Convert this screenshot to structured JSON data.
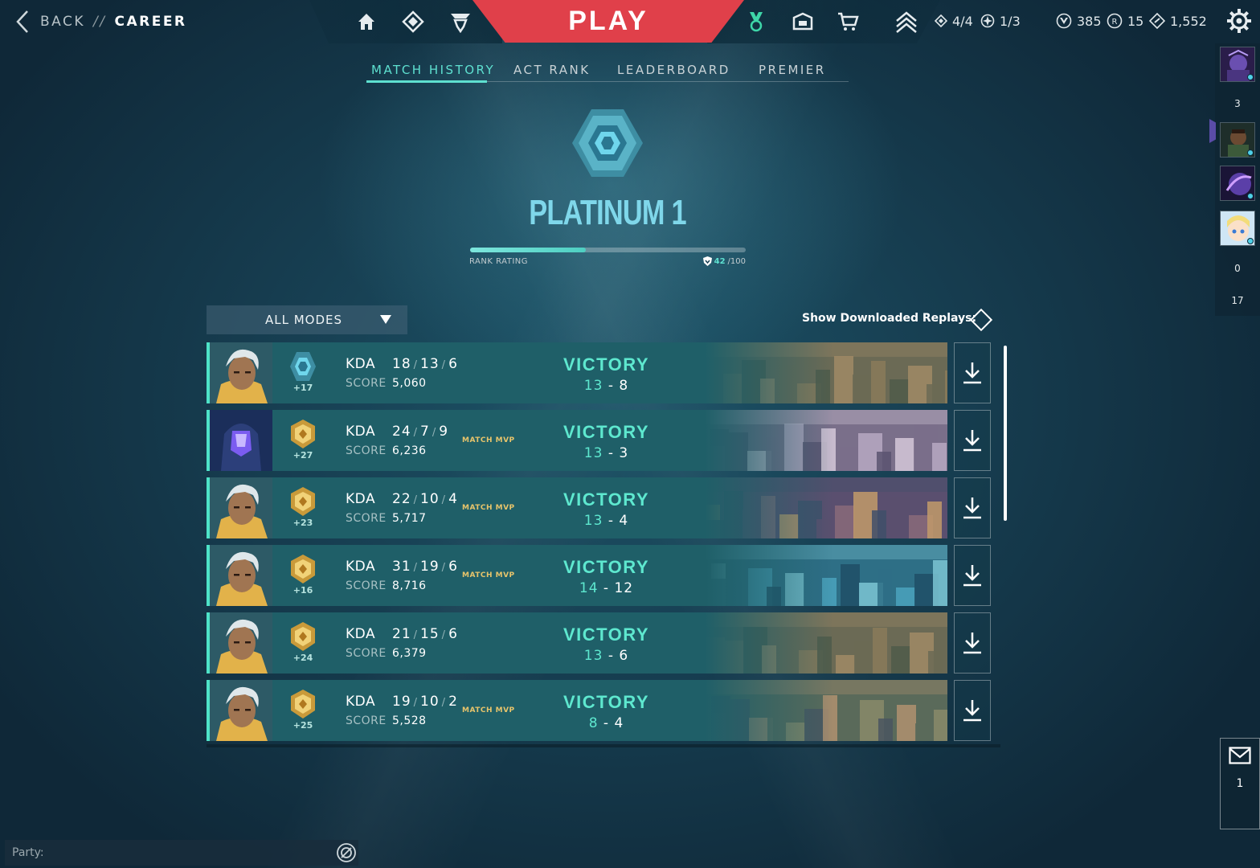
{
  "nav": {
    "back_label": "BACK",
    "separator": "//",
    "section_label": "CAREER",
    "play_label": "PLAY",
    "left_icons": [
      "home-icon",
      "collection-icon",
      "agents-icon"
    ],
    "right_icons": [
      "battlepass-icon",
      "social-icon",
      "store-icon"
    ]
  },
  "stats": {
    "missions": "4/4",
    "weekly": "1/3",
    "valorant_points": "385",
    "radianite": "15",
    "kingdom_credits": "1,552"
  },
  "tabs": [
    {
      "label": "MATCH HISTORY",
      "active": true
    },
    {
      "label": "ACT RANK",
      "active": false
    },
    {
      "label": "LEADERBOARD",
      "active": false
    },
    {
      "label": "PREMIER",
      "active": false
    }
  ],
  "rank": {
    "name": "PLATINUM 1",
    "rating_label": "RANK RATING",
    "rating_current": "42",
    "rating_max": "/100",
    "rating_fraction": 0.42
  },
  "filter": {
    "modes_label": "ALL MODES",
    "replays_label": "Show Downloaded Replays:"
  },
  "matches": [
    {
      "agent": "agent-portrait-neon",
      "rr": "+17",
      "badge": "platinum",
      "kda_label": "KDA",
      "k": "18",
      "d": "13",
      "a": "6",
      "score_label": "SCORE",
      "score": "5,060",
      "mvp": "",
      "result": "VICTORY",
      "won": "13",
      "lost": "8",
      "map": "map-1"
    },
    {
      "agent": "agent-portrait-iso",
      "rr": "+27",
      "badge": "gold",
      "kda_label": "KDA",
      "k": "24",
      "d": "7",
      "a": "9",
      "score_label": "SCORE",
      "score": "6,236",
      "mvp": "MATCH MVP",
      "result": "VICTORY",
      "won": "13",
      "lost": "3",
      "map": "map-2"
    },
    {
      "agent": "agent-portrait-neon",
      "rr": "+23",
      "badge": "gold",
      "kda_label": "KDA",
      "k": "22",
      "d": "10",
      "a": "4",
      "score_label": "SCORE",
      "score": "5,717",
      "mvp": "MATCH MVP",
      "result": "VICTORY",
      "won": "13",
      "lost": "4",
      "map": "map-3"
    },
    {
      "agent": "agent-portrait-neon",
      "rr": "+16",
      "badge": "gold",
      "kda_label": "KDA",
      "k": "31",
      "d": "19",
      "a": "6",
      "score_label": "SCORE",
      "score": "8,716",
      "mvp": "MATCH MVP",
      "result": "VICTORY",
      "won": "14",
      "lost": "12",
      "map": "map-4"
    },
    {
      "agent": "agent-portrait-neon",
      "rr": "+24",
      "badge": "gold",
      "kda_label": "KDA",
      "k": "21",
      "d": "15",
      "a": "6",
      "score_label": "SCORE",
      "score": "6,379",
      "mvp": "",
      "result": "VICTORY",
      "won": "13",
      "lost": "6",
      "map": "map-1"
    },
    {
      "agent": "agent-portrait-neon",
      "rr": "+25",
      "badge": "gold",
      "kda_label": "KDA",
      "k": "19",
      "d": "10",
      "a": "2",
      "score_label": "SCORE",
      "score": "5,528",
      "mvp": "MATCH MVP",
      "result": "VICTORY",
      "won": "8",
      "lost": "4",
      "map": "map-5"
    }
  ],
  "party": {
    "label": "Party:"
  },
  "sidebar": {
    "count_top": "3",
    "count_mid": "0",
    "count_bottom": "17",
    "mail_count": "1"
  },
  "colors": {
    "accent": "#5ee8cf",
    "play": "#e0404a",
    "row_bg": "#1f5f68",
    "mvp": "#e7c46b",
    "rank_text": "#7fd7ea"
  }
}
